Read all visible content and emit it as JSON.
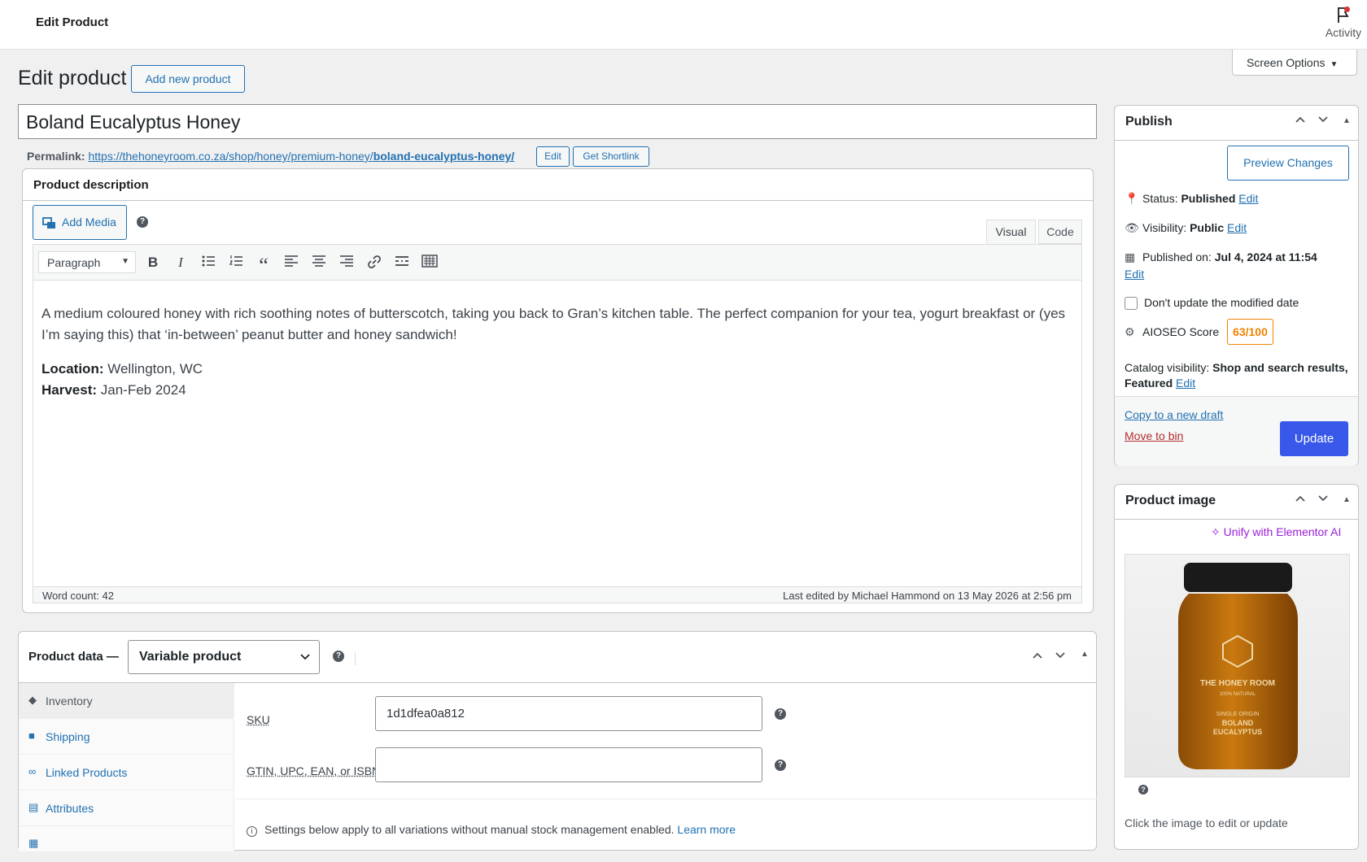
{
  "topbar": {
    "title": "Edit Product",
    "activity_label": "Activity"
  },
  "screen_options": {
    "label": "Screen Options"
  },
  "heading": {
    "title": "Edit product",
    "add_new": "Add new product"
  },
  "product_title": "Boland Eucalyptus Honey",
  "permalink": {
    "label": "Permalink:",
    "url_base": "https://thehoneyroom.co.za/shop/honey/premium-honey/",
    "slug": "boland-eucalyptus-honey/",
    "edit": "Edit",
    "shortlink": "Get Shortlink"
  },
  "description": {
    "heading": "Product description",
    "add_media": "Add Media",
    "tabs": {
      "visual": "Visual",
      "code": "Code"
    },
    "format": "Paragraph",
    "paragraph": "A medium coloured honey with rich soothing notes of butterscotch, taking you back to Gran’s kitchen table. The perfect companion for your tea, yogurt breakfast or (yes I’m saying this) that ‘in-between’ peanut butter and honey sandwich!",
    "location_label": "Location:",
    "location_value": " Wellington, WC",
    "harvest_label": "Harvest:",
    "harvest_value": " Jan-Feb 2024",
    "word_count": "Word count: 42",
    "last_edited": "Last edited by Michael Hammond on 13 May 2026 at 2:56 pm"
  },
  "product_data": {
    "heading": "Product data —",
    "type": "Variable product",
    "tabs": [
      {
        "label": "Inventory"
      },
      {
        "label": "Shipping"
      },
      {
        "label": "Linked Products"
      },
      {
        "label": "Attributes"
      }
    ],
    "sku_label": "SKU",
    "sku_value": "1d1dfea0a812",
    "gtin_label": "GTIN, UPC, EAN, or ISBN",
    "gtin_value": "",
    "note": "Settings below apply to all variations without manual stock management enabled.",
    "learn_more": "Learn more"
  },
  "publish": {
    "heading": "Publish",
    "preview": "Preview Changes",
    "status_label": "Status: ",
    "status_value": "Published",
    "visibility_label": "Visibility: ",
    "visibility_value": "Public",
    "published_label": "Published on: ",
    "published_value": "Jul 4, 2024 at 11:54",
    "edit": "Edit",
    "dont_update": "Don't update the modified date",
    "aioseo_label": "AIOSEO Score",
    "aioseo_score": "63/100",
    "catalog_label": "Catalog visibility: ",
    "catalog_value": "Shop and search results, Featured",
    "copy_draft": "Copy to a new draft",
    "move_bin": "Move to bin",
    "update": "Update"
  },
  "product_image": {
    "heading": "Product image",
    "unify": "Unify with Elementor AI",
    "jar_brand": "THE HONEY ROOM",
    "jar_sub": "100% NATURAL",
    "jar_origin": "SINGLE ORIGIN",
    "jar_name1": "BOLAND",
    "jar_name2": "EUCALYPTUS",
    "caption": "Click the image to edit or update"
  },
  "colors": {
    "accent": "#2271b1",
    "update": "#3858e9",
    "score": "#f18200",
    "elementor": "#9b20d9",
    "danger": "#b32d2e"
  }
}
